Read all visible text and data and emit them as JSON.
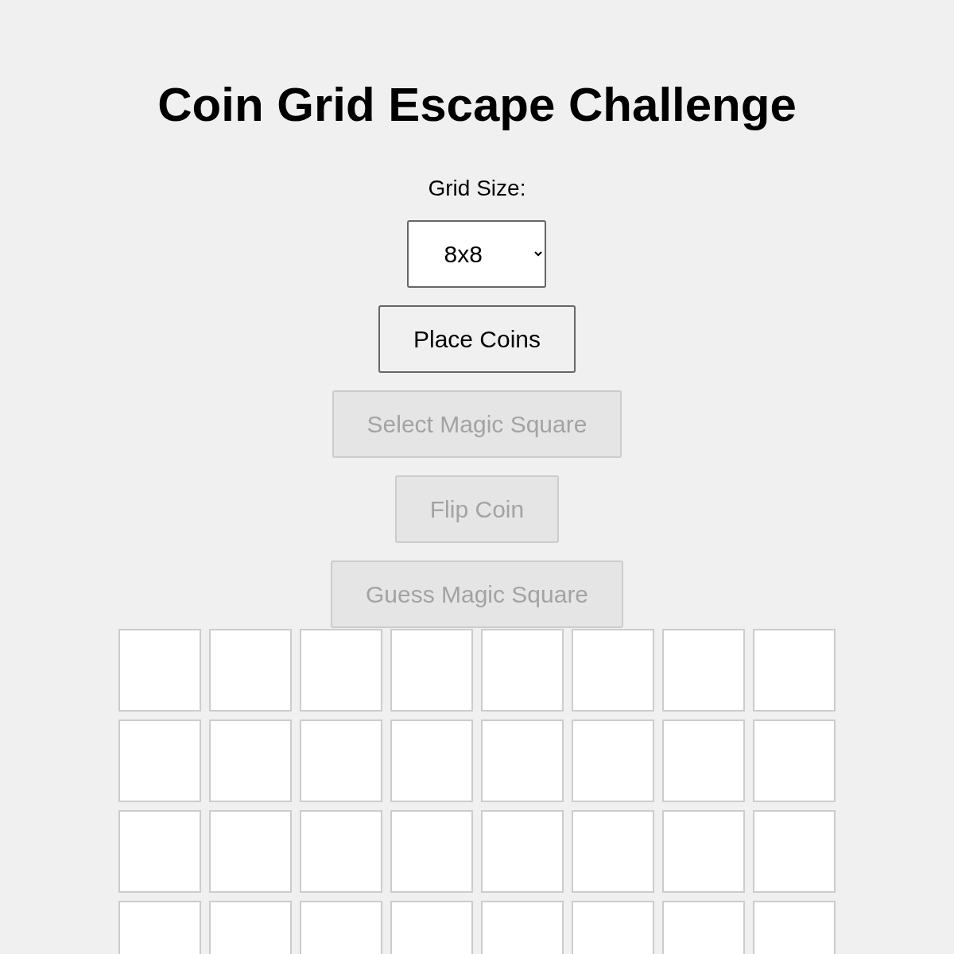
{
  "title": "Coin Grid Escape Challenge",
  "grid_size": {
    "label": "Grid Size:",
    "value": "8x8"
  },
  "buttons": [
    {
      "label": "Place Coins",
      "disabled": false
    },
    {
      "label": "Select Magic Square",
      "disabled": true
    },
    {
      "label": "Flip Coin",
      "disabled": true
    },
    {
      "label": "Guess Magic Square",
      "disabled": true
    }
  ],
  "grid": {
    "rows": [
      {
        "cells": [
          {
            "kind": "empty"
          },
          {
            "kind": "empty"
          },
          {
            "kind": "empty"
          },
          {
            "kind": "empty"
          },
          {
            "kind": "empty"
          },
          {
            "kind": "empty"
          },
          {
            "kind": "empty"
          },
          {
            "kind": "empty"
          }
        ]
      },
      {
        "cells": [
          {
            "kind": "empty"
          },
          {
            "kind": "empty"
          },
          {
            "kind": "empty"
          },
          {
            "kind": "empty"
          },
          {
            "kind": "empty"
          },
          {
            "kind": "empty"
          },
          {
            "kind": "empty"
          },
          {
            "kind": "empty"
          }
        ]
      },
      {
        "cells": [
          {
            "kind": "empty"
          },
          {
            "kind": "empty"
          },
          {
            "kind": "empty"
          },
          {
            "kind": "empty"
          },
          {
            "kind": "empty"
          },
          {
            "kind": "empty"
          },
          {
            "kind": "empty"
          },
          {
            "kind": "empty"
          }
        ]
      },
      {
        "cells": [
          {
            "kind": "empty"
          },
          {
            "kind": "empty"
          },
          {
            "kind": "empty"
          },
          {
            "kind": "empty"
          },
          {
            "kind": "empty"
          },
          {
            "kind": "empty"
          },
          {
            "kind": "empty"
          },
          {
            "kind": "empty"
          }
        ]
      }
    ]
  }
}
